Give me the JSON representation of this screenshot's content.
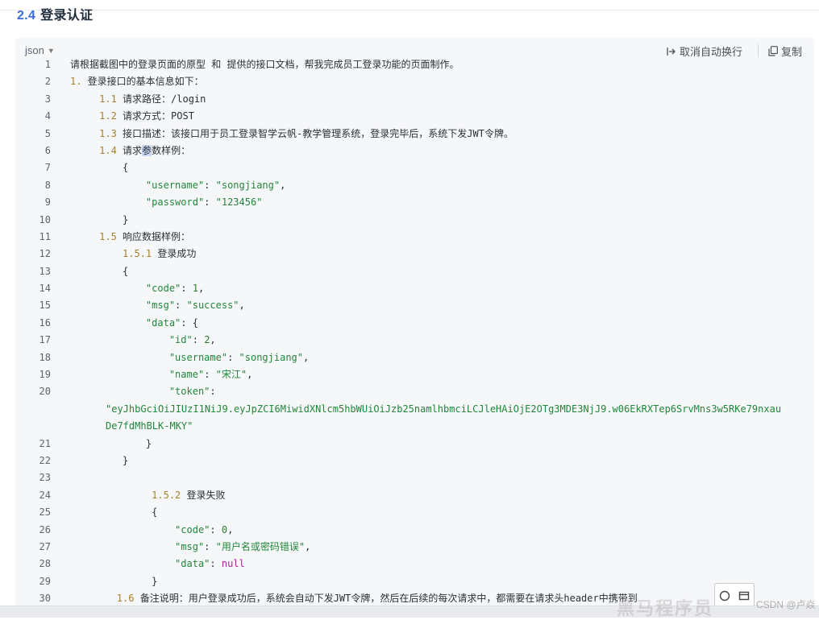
{
  "page": {
    "section_number": "2.4",
    "section_title": "登录认证"
  },
  "code_block": {
    "language": "json",
    "wrap_label": "取消自动换行",
    "copy_label": "复制",
    "lines": [
      {
        "n": "1",
        "segs": [
          [
            "p",
            "请根据截图中的登录页面的原型 和 提供的接口文档，帮我完成员工登录功能的页面制作。"
          ]
        ]
      },
      {
        "n": "2",
        "segs": [
          [
            "sn",
            "1."
          ],
          [
            "p",
            " 登录接口的基本信息如下："
          ]
        ]
      },
      {
        "n": "3",
        "indent": "     ",
        "segs": [
          [
            "sn",
            "1.1"
          ],
          [
            "p",
            " 请求路径：/login"
          ]
        ]
      },
      {
        "n": "4",
        "indent": "     ",
        "segs": [
          [
            "sn",
            "1.2"
          ],
          [
            "p",
            " 请求方式：POST"
          ]
        ]
      },
      {
        "n": "5",
        "indent": "     ",
        "segs": [
          [
            "sn",
            "1.3"
          ],
          [
            "p",
            " 接口描述：该接口用于员工登录智学云帆-教学管理系统，登录完毕后，系统下发JWT令牌。"
          ]
        ]
      },
      {
        "n": "6",
        "indent": "     ",
        "segs": [
          [
            "sn",
            "1.4"
          ],
          [
            "p",
            " 请求"
          ],
          [
            "hl",
            "参"
          ],
          [
            "p",
            "数样例："
          ]
        ]
      },
      {
        "n": "7",
        "indent": "         ",
        "segs": [
          [
            "p",
            "{"
          ]
        ]
      },
      {
        "n": "8",
        "indent": "             ",
        "segs": [
          [
            "k",
            "\"username\""
          ],
          [
            "p",
            ": "
          ],
          [
            "s",
            "\"songjiang\""
          ],
          [
            "p",
            ","
          ]
        ]
      },
      {
        "n": "9",
        "indent": "             ",
        "segs": [
          [
            "k",
            "\"password\""
          ],
          [
            "p",
            ": "
          ],
          [
            "s",
            "\"123456\""
          ]
        ]
      },
      {
        "n": "10",
        "indent": "         ",
        "segs": [
          [
            "p",
            "}"
          ]
        ]
      },
      {
        "n": "11",
        "indent": "     ",
        "segs": [
          [
            "sn",
            "1.5"
          ],
          [
            "p",
            " 响应数据样例："
          ]
        ]
      },
      {
        "n": "12",
        "indent": "         ",
        "segs": [
          [
            "sn",
            "1.5.1"
          ],
          [
            "p",
            " 登录成功"
          ]
        ]
      },
      {
        "n": "13",
        "indent": "         ",
        "segs": [
          [
            "p",
            "{"
          ]
        ]
      },
      {
        "n": "14",
        "indent": "             ",
        "segs": [
          [
            "k",
            "\"code\""
          ],
          [
            "p",
            ": "
          ],
          [
            "n",
            "1"
          ],
          [
            "p",
            ","
          ]
        ]
      },
      {
        "n": "15",
        "indent": "             ",
        "segs": [
          [
            "k",
            "\"msg\""
          ],
          [
            "p",
            ": "
          ],
          [
            "s",
            "\"success\""
          ],
          [
            "p",
            ","
          ]
        ]
      },
      {
        "n": "16",
        "indent": "             ",
        "segs": [
          [
            "k",
            "\"data\""
          ],
          [
            "p",
            ": {"
          ]
        ]
      },
      {
        "n": "17",
        "indent": "                 ",
        "segs": [
          [
            "k",
            "\"id\""
          ],
          [
            "p",
            ": "
          ],
          [
            "n",
            "2"
          ],
          [
            "p",
            ","
          ]
        ]
      },
      {
        "n": "18",
        "indent": "                 ",
        "segs": [
          [
            "k",
            "\"username\""
          ],
          [
            "p",
            ": "
          ],
          [
            "s",
            "\"songjiang\""
          ],
          [
            "p",
            ","
          ]
        ]
      },
      {
        "n": "19",
        "indent": "                 ",
        "segs": [
          [
            "k",
            "\"name\""
          ],
          [
            "p",
            ": "
          ],
          [
            "s",
            "\"宋江\""
          ],
          [
            "p",
            ","
          ]
        ]
      },
      {
        "n": "20",
        "indent": "                 ",
        "segs": [
          [
            "k",
            "\"token\""
          ],
          [
            "p",
            ":"
          ]
        ],
        "cont": [
          [
            [
              "s",
              "\"eyJhbGciOiJIUzI1NiJ9.eyJpZCI6MiwidXNlcm5hbWUiOiJzb25namlhbmciLCJleHAiOjE2OTg3MDE3NjJ9.w06EkRXTep6SrvMns3w5RKe79nxau"
            ]
          ],
          [
            [
              "s",
              "De7fdMhBLK-MKY\""
            ]
          ]
        ]
      },
      {
        "n": "21",
        "indent": "             ",
        "segs": [
          [
            "p",
            "}"
          ]
        ]
      },
      {
        "n": "22",
        "indent": "         ",
        "segs": [
          [
            "p",
            "}"
          ]
        ]
      },
      {
        "n": "23",
        "segs": []
      },
      {
        "n": "24",
        "indent": "              ",
        "segs": [
          [
            "sn",
            "1.5.2"
          ],
          [
            "p",
            " 登录失败"
          ]
        ]
      },
      {
        "n": "25",
        "indent": "              ",
        "segs": [
          [
            "p",
            "{"
          ]
        ]
      },
      {
        "n": "26",
        "indent": "                  ",
        "segs": [
          [
            "k",
            "\"code\""
          ],
          [
            "p",
            ": "
          ],
          [
            "n",
            "0"
          ],
          [
            "p",
            ","
          ]
        ]
      },
      {
        "n": "27",
        "indent": "                  ",
        "segs": [
          [
            "k",
            "\"msg\""
          ],
          [
            "p",
            ": "
          ],
          [
            "s",
            "\"用户名或密码错误\""
          ],
          [
            "p",
            ","
          ]
        ]
      },
      {
        "n": "28",
        "indent": "                  ",
        "segs": [
          [
            "k",
            "\"data\""
          ],
          [
            "p",
            ": "
          ],
          [
            "nul",
            "null"
          ]
        ]
      },
      {
        "n": "29",
        "indent": "              ",
        "segs": [
          [
            "p",
            "}"
          ]
        ]
      },
      {
        "n": "30",
        "indent": "        ",
        "segs": [
          [
            "sn",
            "1.6"
          ],
          [
            "p",
            " 备注说明：用户登录成功后，系统会自动下发JWT令牌，然后在后续的每次请求中，都需要在请求头header中携带到"
          ]
        ]
      }
    ]
  },
  "watermark": {
    "main": "黑马程序员",
    "sub": "CSDN @卢焱"
  },
  "colors": {
    "keys": "#22863a",
    "strings": "#22863a",
    "numbers": "#2e7d32",
    "null": "#a626a4",
    "section_numbers": "#a67f2a",
    "heading_number": "#3f6ad8"
  }
}
